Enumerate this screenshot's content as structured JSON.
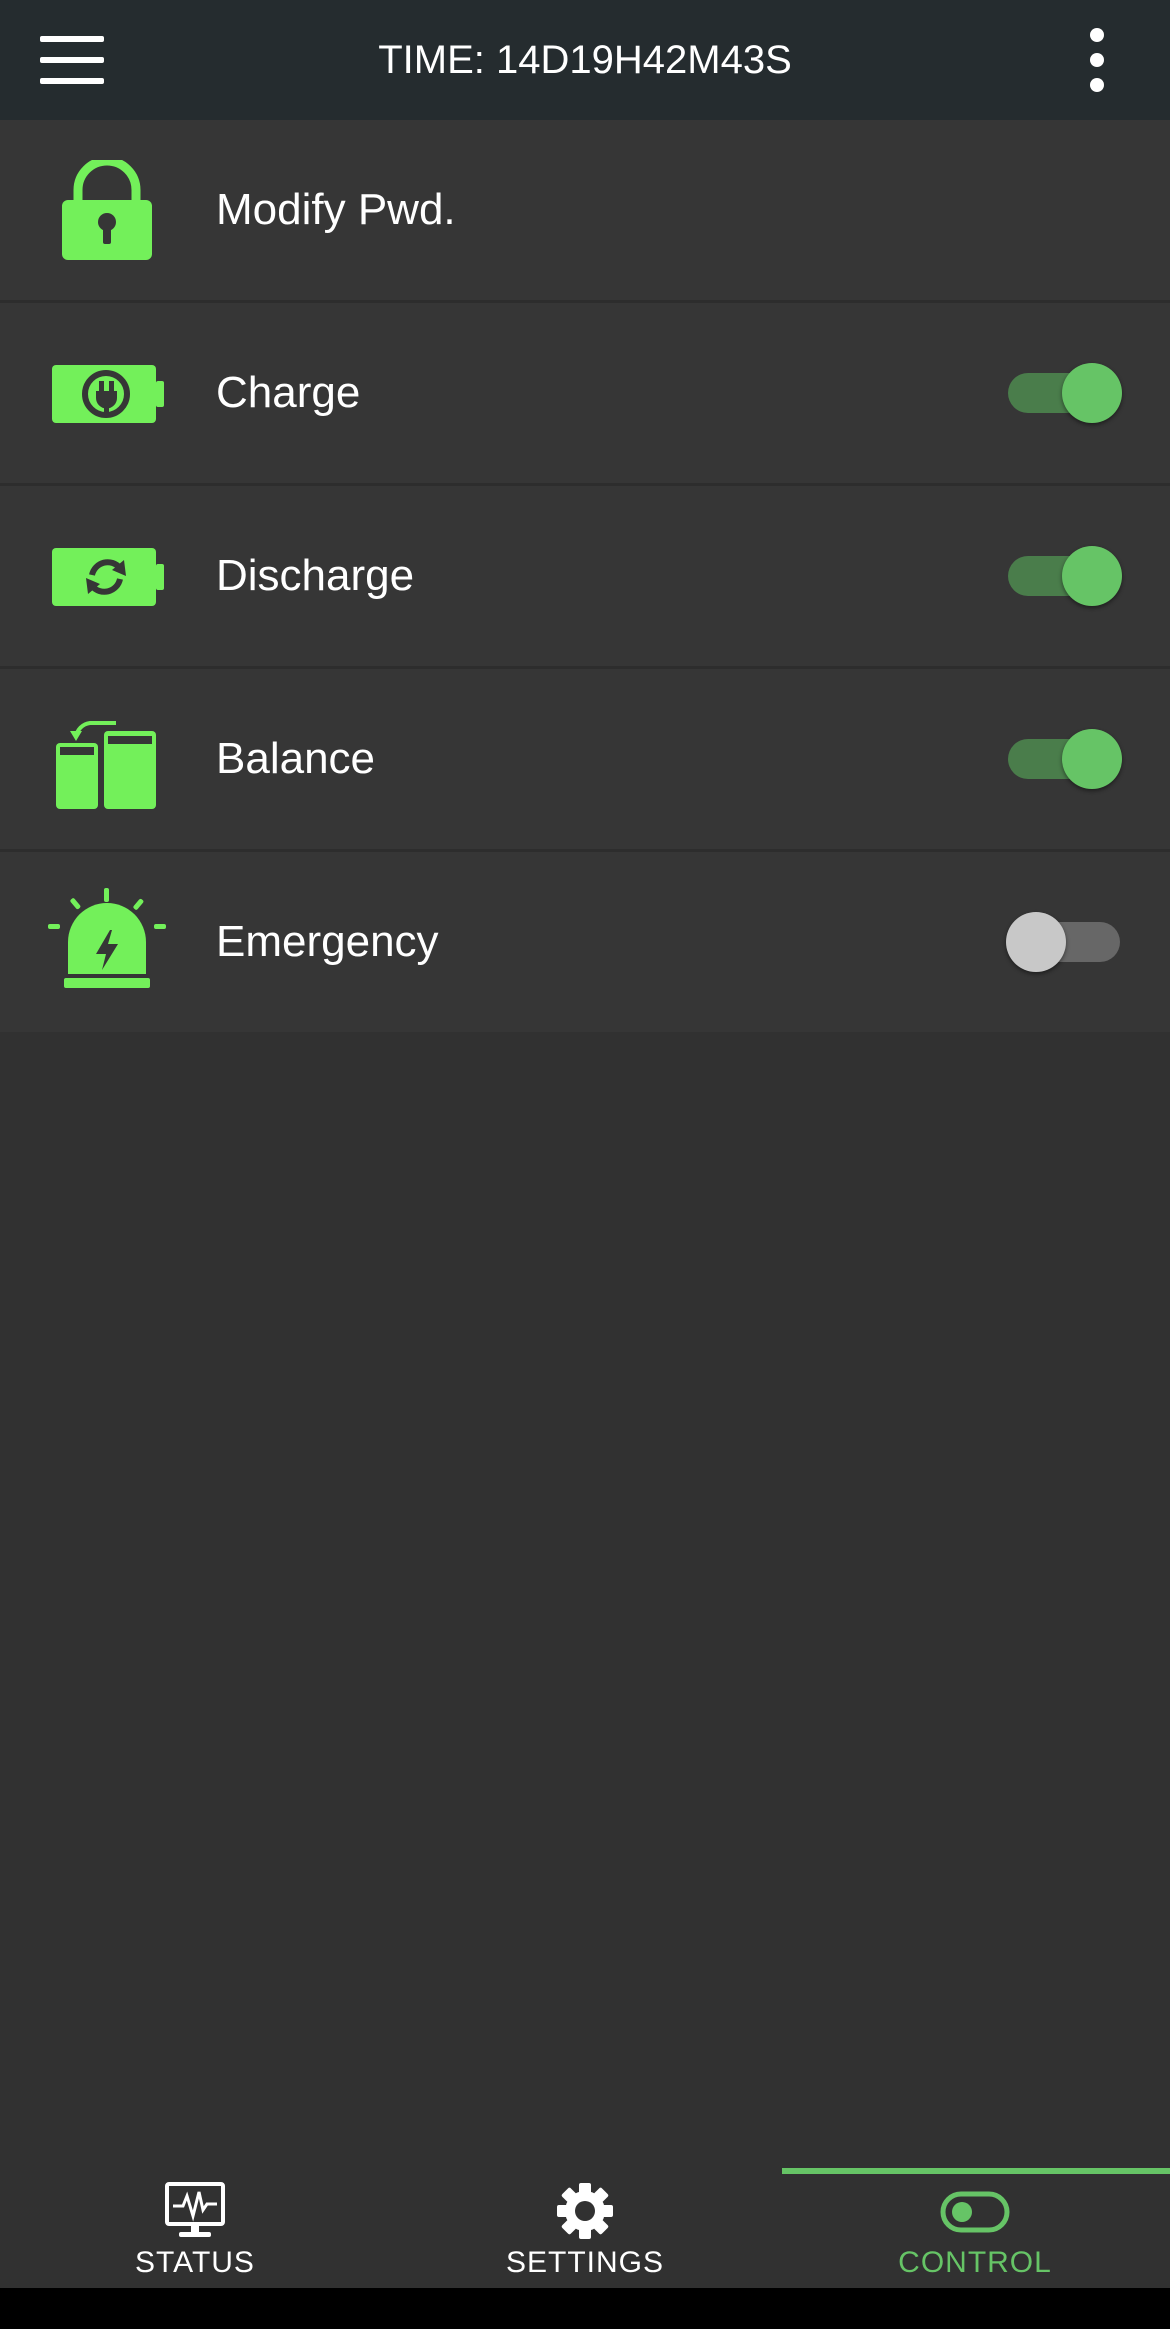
{
  "header": {
    "title": "TIME: 14D19H42M43S",
    "menu_icon": "hamburger-menu-icon",
    "overflow_icon": "more-vertical-icon"
  },
  "controls": [
    {
      "label": "Modify Pwd.",
      "icon": "lock-icon",
      "has_switch": false
    },
    {
      "label": "Charge",
      "icon": "battery-plug-icon",
      "has_switch": true,
      "on": true
    },
    {
      "label": "Discharge",
      "icon": "battery-cycle-icon",
      "has_switch": true,
      "on": true
    },
    {
      "label": "Balance",
      "icon": "cells-balance-icon",
      "has_switch": true,
      "on": true
    },
    {
      "label": "Emergency",
      "icon": "siren-icon",
      "has_switch": true,
      "on": false
    }
  ],
  "bottom_nav": {
    "items": [
      {
        "label": "STATUS",
        "icon": "monitor-pulse-icon",
        "active": false
      },
      {
        "label": "SETTINGS",
        "icon": "gear-icon",
        "active": false
      },
      {
        "label": "CONTROL",
        "icon": "toggle-icon",
        "active": true
      }
    ]
  },
  "colors": {
    "accent": "#66c466",
    "icon_green": "#73f05a",
    "background": "#313131",
    "row_background": "#363636",
    "header_background": "#252c2f"
  }
}
